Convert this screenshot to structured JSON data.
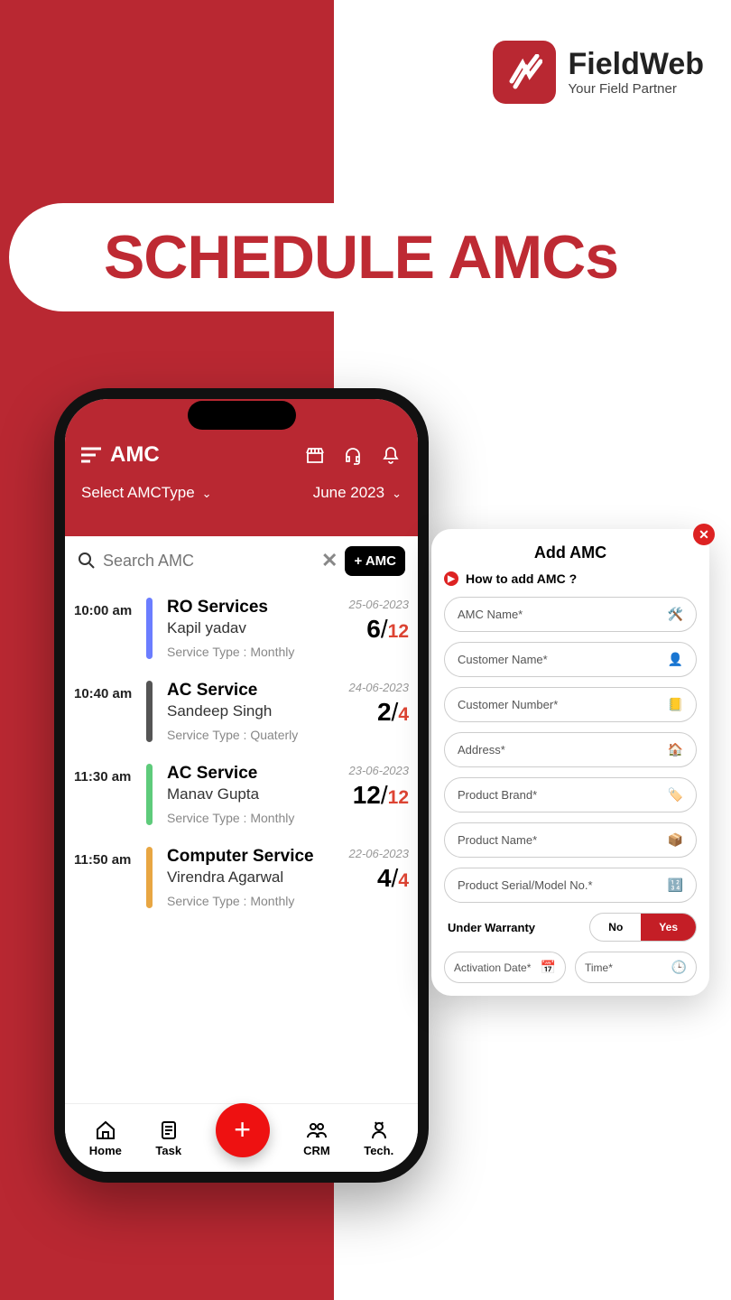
{
  "brand": {
    "name": "FieldWeb",
    "tagline": "Your Field Partner"
  },
  "page_title": "SCHEDULE AMCs",
  "header": {
    "title": "AMC",
    "type_selector": "Select AMCType",
    "month": "June 2023"
  },
  "search": {
    "placeholder": "Search AMC",
    "add_button": "+ AMC"
  },
  "items": [
    {
      "time": "10:00 am",
      "service": "RO Services",
      "customer": "Kapil yadav",
      "meta": "Service Type : Monthly",
      "date": "25-06-2023",
      "done": "6",
      "total": "12",
      "color": "#6b7dff"
    },
    {
      "time": "10:40 am",
      "service": "AC Service",
      "customer": "Sandeep Singh",
      "meta": "Service Type : Quaterly",
      "date": "24-06-2023",
      "done": "2",
      "total": "4",
      "color": "#555"
    },
    {
      "time": "11:30 am",
      "service": "AC Service",
      "customer": "Manav Gupta",
      "meta": "Service Type : Monthly",
      "date": "23-06-2023",
      "done": "12",
      "total": "12",
      "color": "#5ecb7b"
    },
    {
      "time": "11:50 am",
      "service": "Computer Service",
      "customer": "Virendra Agarwal",
      "meta": "Service Type : Monthly",
      "date": "22-06-2023",
      "done": "4",
      "total": "4",
      "color": "#e8a642"
    }
  ],
  "nav": {
    "home": "Home",
    "task": "Task",
    "crm": "CRM",
    "tech": "Tech."
  },
  "modal": {
    "title": "Add AMC",
    "howto": "How to add AMC ?",
    "fields": {
      "amc_name": "AMC Name*",
      "customer_name": "Customer Name*",
      "customer_number": "Customer Number*",
      "address": "Address*",
      "product_brand": "Product Brand*",
      "product_name": "Product Name*",
      "serial": "Product Serial/Model No.*",
      "warranty_label": "Under Warranty",
      "no": "No",
      "yes": "Yes",
      "activation": "Activation Date*",
      "time": "Time*"
    }
  }
}
